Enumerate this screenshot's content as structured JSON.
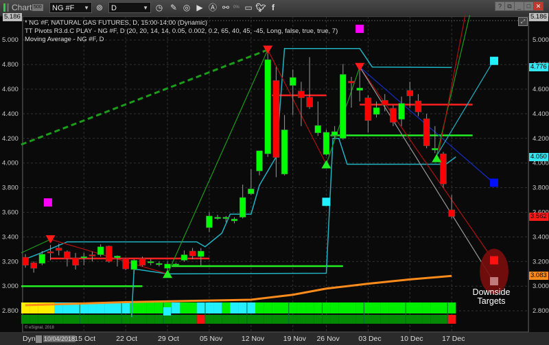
{
  "toolbar": {
    "title": "Chart",
    "chart_badge": "500",
    "symbol": "NG #F",
    "interval": "D",
    "percent_label": "0%",
    "icons": [
      "link-icon",
      "clock-icon",
      "pencil-icon",
      "indicator-icon",
      "play-icon",
      "alert-icon",
      "chain-icon",
      "chat-icon",
      "twitter-icon",
      "facebook-icon"
    ],
    "window_buttons": [
      "?",
      "⧉",
      "_",
      "□",
      "✕"
    ]
  },
  "legend": {
    "line1": "* NG #F, NATURAL GAS FUTURES, D, 15:00-14:00 (Dynamic)",
    "line2": "TT Pivots R3.d.C PLAY - NG #F, D (20, 20, 14, 14, 0.05, 0.002, 0.2, 65, 40, 45, -45, Long, false, true, true, 7)",
    "line3": "Moving Average - NG #F, D"
  },
  "copyright": "© eSignal, 2018",
  "bottom_bar": {
    "mode": "Dyn",
    "start_date": "10/04/2018"
  },
  "annotation": {
    "line1": "Downside",
    "line2": "Targets"
  },
  "chart_data": {
    "type": "candlestick",
    "title": "",
    "ylim": [
      2.72,
      5.22
    ],
    "yticks": [
      "5.000",
      "4.800",
      "4.600",
      "4.400",
      "4.200",
      "4.000",
      "3.800",
      "3.600",
      "3.400",
      "3.200",
      "3.000",
      "2.800"
    ],
    "xtick_labels": [
      {
        "date": "15 Oct",
        "bar": 7
      },
      {
        "date": "22 Oct",
        "bar": 12
      },
      {
        "date": "29 Oct",
        "bar": 17
      },
      {
        "date": "05 Nov",
        "bar": 22
      },
      {
        "date": "12 Nov",
        "bar": 27
      },
      {
        "date": "19 Nov",
        "bar": 32
      },
      {
        "date": "26 Nov",
        "bar": 36
      },
      {
        "date": "03 Dec",
        "bar": 41
      },
      {
        "date": "10 Dec",
        "bar": 46
      },
      {
        "date": "17 Dec",
        "bar": 51
      }
    ],
    "grid": true,
    "colors": {
      "up": "#00ff00",
      "down": "#ff0000",
      "wick": "#9a9a9a",
      "ma": "#ff8c1a",
      "stop": "#1fb3c4",
      "pivot_red": "#ff2020",
      "pivot_green": "#22ee22"
    },
    "candles": [
      {
        "d": "2018-10-04",
        "o": 3.235,
        "h": 3.26,
        "l": 3.15,
        "c": 3.17
      },
      {
        "d": "2018-10-05",
        "o": 3.19,
        "h": 3.2,
        "l": 3.11,
        "c": 3.145
      },
      {
        "d": "2018-10-08",
        "o": 3.185,
        "h": 3.285,
        "l": 3.17,
        "c": 3.26
      },
      {
        "d": "2018-10-09",
        "o": 3.28,
        "h": 3.335,
        "l": 3.21,
        "c": 3.27
      },
      {
        "d": "2018-10-10",
        "o": 3.31,
        "h": 3.345,
        "l": 3.25,
        "c": 3.29
      },
      {
        "d": "2018-10-11",
        "o": 3.28,
        "h": 3.29,
        "l": 3.16,
        "c": 3.225
      },
      {
        "d": "2018-10-12",
        "o": 3.23,
        "h": 3.27,
        "l": 3.135,
        "c": 3.17
      },
      {
        "d": "2018-10-15",
        "o": 3.23,
        "h": 3.27,
        "l": 3.17,
        "c": 3.24
      },
      {
        "d": "2018-10-16",
        "o": 3.255,
        "h": 3.28,
        "l": 3.2,
        "c": 3.245
      },
      {
        "d": "2018-10-17",
        "o": 3.255,
        "h": 3.34,
        "l": 3.24,
        "c": 3.32
      },
      {
        "d": "2018-10-18",
        "o": 3.325,
        "h": 3.33,
        "l": 3.19,
        "c": 3.2
      },
      {
        "d": "2018-10-19",
        "o": 3.23,
        "h": 3.25,
        "l": 3.16,
        "c": 3.245
      },
      {
        "d": "2018-10-22",
        "o": 3.225,
        "h": 3.23,
        "l": 3.13,
        "c": 3.14
      },
      {
        "d": "2018-10-23",
        "o": 3.135,
        "h": 3.22,
        "l": 3.1,
        "c": 3.21
      },
      {
        "d": "2018-10-24",
        "o": 3.225,
        "h": 3.24,
        "l": 3.16,
        "c": 3.17
      },
      {
        "d": "2018-10-25",
        "o": 3.19,
        "h": 3.22,
        "l": 3.17,
        "c": 3.2
      },
      {
        "d": "2018-10-26",
        "o": 3.175,
        "h": 3.2,
        "l": 3.16,
        "c": 3.185
      },
      {
        "d": "2018-10-29",
        "o": 3.145,
        "h": 3.2,
        "l": 3.13,
        "c": 3.18
      },
      {
        "d": "2018-10-30",
        "o": 3.18,
        "h": 3.19,
        "l": 3.17,
        "c": 3.18
      },
      {
        "d": "2018-10-31",
        "o": 3.21,
        "h": 3.29,
        "l": 3.2,
        "c": 3.255
      },
      {
        "d": "2018-11-01",
        "o": 3.285,
        "h": 3.31,
        "l": 3.22,
        "c": 3.245
      },
      {
        "d": "2018-11-02",
        "o": 3.24,
        "h": 3.31,
        "l": 3.17,
        "c": 3.285
      },
      {
        "d": "2018-11-05",
        "o": 3.475,
        "h": 3.6,
        "l": 3.44,
        "c": 3.57
      },
      {
        "d": "2018-11-06",
        "o": 3.56,
        "h": 3.58,
        "l": 3.54,
        "c": 3.56
      },
      {
        "d": "2018-11-07",
        "o": 3.55,
        "h": 3.57,
        "l": 3.52,
        "c": 3.56
      },
      {
        "d": "2018-11-08",
        "o": 3.53,
        "h": 3.56,
        "l": 3.51,
        "c": 3.545
      },
      {
        "d": "2018-11-09",
        "o": 3.56,
        "h": 3.825,
        "l": 3.55,
        "c": 3.72
      },
      {
        "d": "2018-11-12",
        "o": 3.75,
        "h": 3.95,
        "l": 3.74,
        "c": 3.79
      },
      {
        "d": "2018-11-13",
        "o": 3.935,
        "h": 4.1,
        "l": 3.9,
        "c": 4.1
      },
      {
        "d": "2018-11-14",
        "o": 4.075,
        "h": 4.92,
        "l": 4.05,
        "c": 4.84
      },
      {
        "d": "2018-11-15",
        "o": 4.67,
        "h": 4.78,
        "l": 3.885,
        "c": 4.045
      },
      {
        "d": "2018-11-16",
        "o": 3.91,
        "h": 4.39,
        "l": 3.9,
        "c": 4.27
      },
      {
        "d": "2018-11-19",
        "o": 4.63,
        "h": 4.76,
        "l": 4.39,
        "c": 4.695
      },
      {
        "d": "2018-11-20",
        "o": 4.585,
        "h": 4.66,
        "l": 4.3,
        "c": 4.53
      },
      {
        "d": "2018-11-21",
        "o": 4.535,
        "h": 4.86,
        "l": 4.44,
        "c": 4.455
      },
      {
        "d": "2018-11-23",
        "o": 4.245,
        "h": 4.5,
        "l": 4.22,
        "c": 4.305
      },
      {
        "d": "2018-11-26",
        "o": 4.07,
        "h": 4.27,
        "l": 4.06,
        "c": 4.25
      },
      {
        "d": "2018-11-27",
        "o": 4.225,
        "h": 4.3,
        "l": 4.2,
        "c": 4.255
      },
      {
        "d": "2018-11-28",
        "o": 4.2,
        "h": 4.805,
        "l": 4.19,
        "c": 4.72
      },
      {
        "d": "2018-11-29",
        "o": 4.665,
        "h": 4.7,
        "l": 4.45,
        "c": 4.65
      },
      {
        "d": "2018-11-30",
        "o": 4.59,
        "h": 4.78,
        "l": 4.5,
        "c": 4.61
      },
      {
        "d": "2018-12-03",
        "o": 4.53,
        "h": 4.55,
        "l": 4.25,
        "c": 4.345
      },
      {
        "d": "2018-12-04",
        "o": 4.395,
        "h": 4.5,
        "l": 4.37,
        "c": 4.45
      },
      {
        "d": "2018-12-05",
        "o": 4.51,
        "h": 4.56,
        "l": 4.42,
        "c": 4.47
      },
      {
        "d": "2018-12-06",
        "o": 4.445,
        "h": 4.47,
        "l": 4.3,
        "c": 4.33
      },
      {
        "d": "2018-12-07",
        "o": 4.355,
        "h": 4.54,
        "l": 4.3,
        "c": 4.485
      },
      {
        "d": "2018-12-10",
        "o": 4.59,
        "h": 4.66,
        "l": 4.45,
        "c": 4.545
      },
      {
        "d": "2018-12-11",
        "o": 4.505,
        "h": 4.56,
        "l": 4.38,
        "c": 4.415
      },
      {
        "d": "2018-12-12",
        "o": 4.36,
        "h": 4.4,
        "l": 4.12,
        "c": 4.14
      },
      {
        "d": "2018-12-13",
        "o": 4.105,
        "h": 4.3,
        "l": 4.08,
        "c": 4.12
      },
      {
        "d": "2018-12-14",
        "o": 4.075,
        "h": 4.09,
        "l": 3.8,
        "c": 3.83
      },
      {
        "d": "2018-12-17",
        "o": 3.62,
        "h": 3.74,
        "l": 3.55,
        "c": 3.565
      }
    ],
    "moving_average": [
      [
        0,
        2.845
      ],
      [
        12,
        2.87
      ],
      [
        27,
        2.89
      ],
      [
        32,
        2.93
      ],
      [
        36,
        2.98
      ],
      [
        41,
        3.02
      ],
      [
        46,
        3.055
      ],
      [
        51,
        3.083
      ]
    ],
    "stop_lines": [
      [
        [
          0,
          3.22
        ],
        [
          1.5,
          3.26
        ],
        [
          5,
          3.36
        ],
        [
          20.5,
          3.36
        ],
        [
          21.5,
          3.32
        ],
        [
          23.5,
          3.43
        ],
        [
          24.5,
          3.585
        ],
        [
          27,
          3.585
        ],
        [
          28,
          3.82
        ],
        [
          30,
          4.05
        ],
        [
          31,
          4.93
        ],
        [
          40,
          4.93
        ],
        [
          41.5,
          4.78
        ],
        [
          51,
          4.776
        ]
      ],
      [
        [
          12.7,
          2.75
        ],
        [
          13,
          3.135
        ],
        [
          13.5,
          3.135
        ],
        [
          17,
          3.1
        ],
        [
          36,
          3.105
        ],
        [
          36.8,
          4.2
        ],
        [
          37.5,
          4.2
        ],
        [
          38.5,
          3.99
        ],
        [
          50.3,
          3.99
        ],
        [
          51.5,
          4.05
        ]
      ]
    ],
    "pivot_lines": [
      {
        "color": "red",
        "price": 3.225,
        "from": 3,
        "to": 22
      },
      {
        "color": "red",
        "price": 4.55,
        "from": 29.5,
        "to": 36
      },
      {
        "color": "red",
        "price": 4.475,
        "from": 40,
        "to": 53.5
      },
      {
        "color": "green",
        "price": 3.0,
        "from": -0.5,
        "to": 14
      },
      {
        "color": "green",
        "price": 3.163,
        "from": 17.5,
        "to": 38
      },
      {
        "color": "green",
        "price": 4.225,
        "from": 36.5,
        "to": 53.5
      }
    ],
    "signals": [
      {
        "type": "sell",
        "bar": 3,
        "price": 3.38
      },
      {
        "type": "sell",
        "bar": 29,
        "price": 4.92
      },
      {
        "type": "sell",
        "bar": 40,
        "price": 4.78
      },
      {
        "type": "buy",
        "bar": 17,
        "price": 3.1
      },
      {
        "type": "buy",
        "bar": 36,
        "price": 3.99
      },
      {
        "type": "buy",
        "bar": 49.2,
        "price": 4.04
      }
    ],
    "zigzag": [
      {
        "color": "green",
        "pts": [
          [
            -0.5,
            3.27
          ],
          [
            3,
            3.38
          ]
        ]
      },
      {
        "color": "red",
        "pts": [
          [
            3,
            3.38
          ],
          [
            17,
            3.1
          ]
        ]
      },
      {
        "color": "green",
        "pts": [
          [
            17,
            3.1
          ],
          [
            29,
            4.92
          ]
        ]
      },
      {
        "color": "red",
        "pts": [
          [
            29,
            4.92
          ],
          [
            36,
            3.99
          ]
        ]
      },
      {
        "color": "green",
        "pts": [
          [
            36,
            3.99
          ],
          [
            40,
            4.78
          ]
        ]
      },
      {
        "color": "green",
        "dashed": true,
        "pts": [
          [
            -0.5,
            4.15
          ],
          [
            29,
            4.92
          ]
        ]
      },
      {
        "color": "red",
        "pts": [
          [
            40,
            4.78
          ],
          [
            56,
            3.21
          ]
        ]
      },
      {
        "color": "gray",
        "pts": [
          [
            40,
            4.78
          ],
          [
            56,
            3.04
          ]
        ]
      },
      {
        "color": "blue",
        "pts": [
          [
            40,
            4.78
          ],
          [
            56,
            3.84
          ]
        ]
      },
      {
        "color": "cyan",
        "pts": [
          [
            49.2,
            4.06
          ],
          [
            56,
            4.83
          ]
        ]
      },
      {
        "color": "green",
        "pts": [
          [
            49.2,
            4.06
          ],
          [
            53.5,
            5.3
          ]
        ]
      },
      {
        "color": "red",
        "pts": [
          [
            49.5,
            4.1
          ],
          [
            52.9,
            5.3
          ]
        ]
      }
    ],
    "markers": [
      {
        "color": "magenta",
        "bar": 2.7,
        "price": 3.68
      },
      {
        "color": "magenta",
        "bar": 40,
        "price": 5.09
      },
      {
        "color": "cyan",
        "bar": 36,
        "price": 3.685
      }
    ],
    "targets": [
      {
        "color": "cyan",
        "price": 4.83
      },
      {
        "color": "blue",
        "price": 3.84
      },
      {
        "color": "red",
        "price": 3.21
      },
      {
        "color": "rosy",
        "price": 3.04
      }
    ],
    "price_tags": [
      {
        "label": "5.186",
        "color": "#bdbdbd",
        "price": 5.186
      },
      {
        "label": "4.776",
        "color": "#33e6f0",
        "price": 4.776
      },
      {
        "label": "4.050",
        "color": "#33e6f0",
        "price": 4.05
      },
      {
        "label": "3.562",
        "color": "#ff1a1a",
        "price": 3.562
      },
      {
        "label": "3.083",
        "color": "#ff8c1a",
        "price": 3.083
      }
    ],
    "trend_strip_top": [
      "yellow",
      "yellow",
      "yellow",
      "yellow",
      "cyan",
      "cyan",
      "cyan",
      "cyan",
      "cyan",
      "cyan",
      "cyan",
      "cyan",
      "cyan",
      "green",
      "green",
      "green",
      "green",
      "green",
      "cyan",
      "green",
      "green",
      "cyan",
      "cyan",
      "cyan",
      "green",
      "cyan",
      "cyan",
      "cyan",
      "green",
      "green",
      "green",
      "green",
      "green",
      "green",
      "green",
      "green",
      "green",
      "green",
      "green",
      "green",
      "green",
      "green",
      "green",
      "green",
      "green",
      "green",
      "green",
      "green",
      "green",
      "green",
      "green",
      "green"
    ],
    "trend_strip_bottom_red_bars": [
      21,
      51
    ],
    "strip_marker": {
      "color": "cyan",
      "bar": 17
    }
  }
}
